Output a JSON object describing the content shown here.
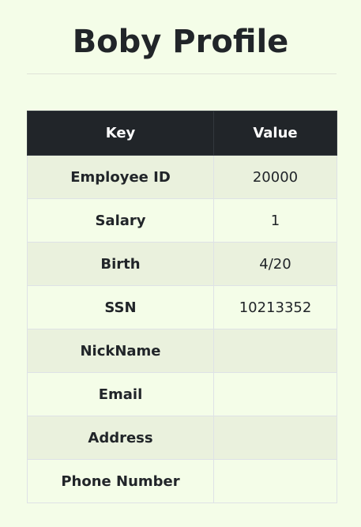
{
  "page": {
    "title": "Boby Profile"
  },
  "table": {
    "headers": {
      "key": "Key",
      "value": "Value"
    },
    "rows": [
      {
        "key": "Employee ID",
        "value": "20000"
      },
      {
        "key": "Salary",
        "value": "1"
      },
      {
        "key": "Birth",
        "value": "4/20"
      },
      {
        "key": "SSN",
        "value": "10213352"
      },
      {
        "key": "NickName",
        "value": ""
      },
      {
        "key": "Email",
        "value": ""
      },
      {
        "key": "Address",
        "value": ""
      },
      {
        "key": "Phone Number",
        "value": ""
      }
    ]
  },
  "colors": {
    "page_background": "#f4fde8",
    "header_background": "#212529",
    "striped_row_background": "#eaf1dd"
  }
}
